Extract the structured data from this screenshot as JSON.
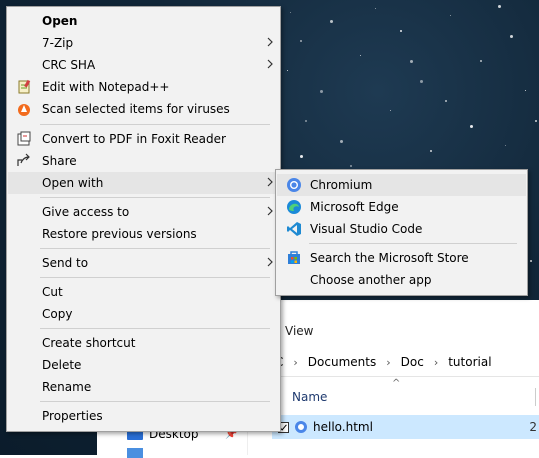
{
  "context_menu": {
    "items": [
      {
        "label": "Open"
      },
      {
        "label": "7-Zip"
      },
      {
        "label": "CRC SHA"
      },
      {
        "label": "Edit with Notepad++"
      },
      {
        "label": "Scan selected items for viruses"
      },
      {
        "label": "Convert to PDF in Foxit Reader"
      },
      {
        "label": "Share"
      },
      {
        "label": "Open with"
      },
      {
        "label": "Give access to"
      },
      {
        "label": "Restore previous versions"
      },
      {
        "label": "Send to"
      },
      {
        "label": "Cut"
      },
      {
        "label": "Copy"
      },
      {
        "label": "Create shortcut"
      },
      {
        "label": "Delete"
      },
      {
        "label": "Rename"
      },
      {
        "label": "Properties"
      }
    ]
  },
  "open_with_submenu": {
    "items": [
      {
        "label": "Chromium"
      },
      {
        "label": "Microsoft Edge"
      },
      {
        "label": "Visual Studio Code"
      },
      {
        "label": "Search the Microsoft Store"
      },
      {
        "label": "Choose another app"
      }
    ]
  },
  "explorer": {
    "ribbon_tab": "View",
    "breadcrumb": [
      "C",
      "Documents",
      "Doc",
      "tutorial"
    ],
    "column_name": "Name",
    "nav_item": "Desktop",
    "file_name": "hello.html",
    "file_col_fragment": "2"
  },
  "colors": {
    "menu_bg": "#f2f2f2",
    "menu_hover": "#e5e5e5",
    "selection": "#cce8ff",
    "desktop_bg": "#112638"
  }
}
